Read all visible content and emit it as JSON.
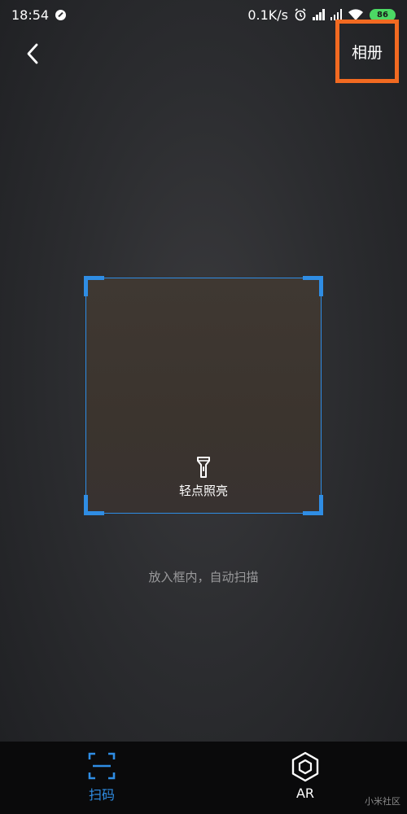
{
  "status_bar": {
    "time": "18:54",
    "network_speed": "0.1K/s",
    "battery_level": "86",
    "icons": [
      "do-not-disturb-icon",
      "alarm-icon",
      "signal-icon",
      "signal-icon",
      "wifi-icon",
      "battery-icon"
    ]
  },
  "header": {
    "back_icon": "chevron-left-icon",
    "album_label": "相册",
    "highlight_color": "#f26a21"
  },
  "scanner": {
    "frame_color": "#2f8de4",
    "flashlight_icon": "flashlight-icon",
    "flashlight_label": "轻点照亮",
    "hint": "放入框内，自动扫描"
  },
  "tab_bar": {
    "tabs": [
      {
        "label": "扫码",
        "icon": "scan-frame-icon",
        "active": true
      },
      {
        "label": "AR",
        "icon": "hexagon-icon",
        "active": false
      }
    ],
    "active_color": "#2f8de4"
  },
  "watermark": "小米社区"
}
